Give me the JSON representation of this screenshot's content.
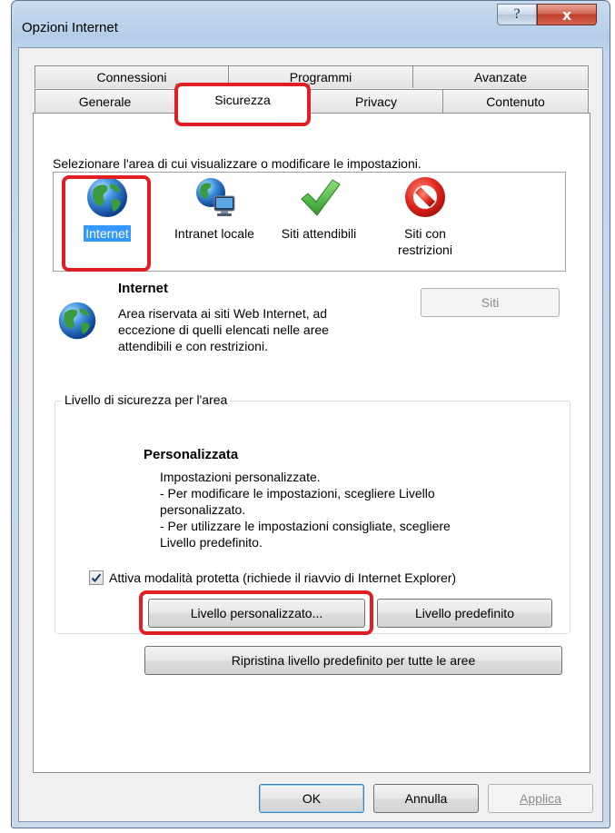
{
  "window": {
    "title": "Opzioni Internet",
    "help_glyph": "?",
    "close_glyph": "x"
  },
  "tabs": {
    "back_row": [
      {
        "label": "Connessioni"
      },
      {
        "label": "Programmi"
      },
      {
        "label": "Avanzate"
      }
    ],
    "front_row": [
      {
        "label": "Generale"
      },
      {
        "label": "Sicurezza",
        "active": true
      },
      {
        "label": "Privacy"
      },
      {
        "label": "Contenuto"
      }
    ]
  },
  "zones": {
    "instruction": "Selezionare l'area di cui visualizzare o modificare le impostazioni.",
    "items": [
      {
        "label": "Internet",
        "icon": "globe-icon",
        "selected": true
      },
      {
        "label": "Intranet locale",
        "icon": "intranet-icon"
      },
      {
        "label": "Siti attendibili",
        "icon": "checkmark-icon"
      },
      {
        "label": "Siti con restrizioni",
        "icon": "prohibited-icon"
      }
    ]
  },
  "zone_info": {
    "title": "Internet",
    "description_lines": [
      "Area riservata ai siti Web Internet, ad",
      "eccezione di quelli elencati nelle aree",
      "attendibili e con restrizioni."
    ],
    "sites_button": "Siti"
  },
  "security_level": {
    "group_label": "Livello di sicurezza per l'area",
    "level_name": "Personalizzata",
    "description_lines": [
      "Impostazioni personalizzate.",
      "- Per modificare le impostazioni, scegliere Livello",
      "personalizzato.",
      "- Per utilizzare le impostazioni consigliate, scegliere",
      "Livello predefinito."
    ],
    "protected_mode_label": "Attiva modalità protetta (richiede il riavvio di Internet Explorer)",
    "protected_mode_checked": true,
    "custom_level_button": "Livello personalizzato...",
    "default_level_button": "Livello predefinito",
    "reset_all_button": "Ripristina livello predefinito per tutte le aree"
  },
  "footer": {
    "ok": "OK",
    "cancel": "Annulla",
    "apply": "Applica"
  },
  "colors": {
    "highlight": "#e21e23",
    "selection": "#3399ff"
  }
}
